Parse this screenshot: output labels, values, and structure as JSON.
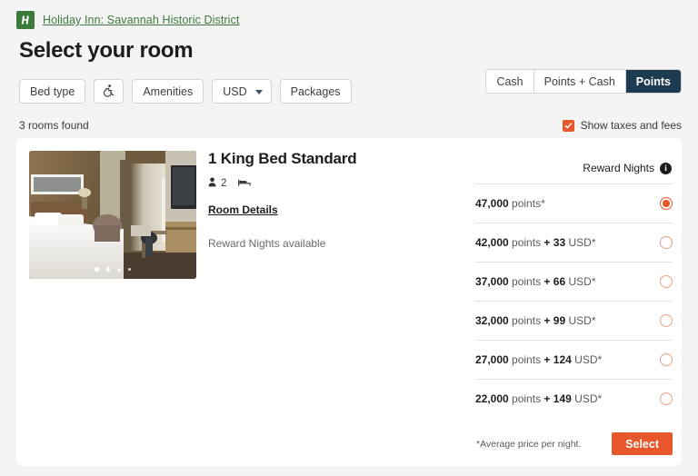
{
  "header": {
    "logo_icon": "holiday-inn-logo-icon",
    "hotel_link": "Holiday Inn: Savannah Historic District",
    "page_title": "Select your room"
  },
  "filters": {
    "items": [
      {
        "label": "Bed type",
        "type": "button"
      },
      {
        "label": "",
        "type": "icon",
        "icon": "accessibility-icon"
      },
      {
        "label": "Amenities",
        "type": "button"
      },
      {
        "label": "USD",
        "type": "select",
        "icon": "chevron-down-icon"
      },
      {
        "label": "Packages",
        "type": "button"
      }
    ]
  },
  "rate_toggle": {
    "options": [
      "Cash",
      "Points + Cash",
      "Points"
    ],
    "selected": "Points",
    "active_color": "#1d3c51"
  },
  "results": {
    "count_label": "3 rooms found",
    "taxes_checkbox": {
      "label": "Show taxes and fees",
      "checked": true,
      "color": "#e8572b",
      "icon": "checkmark-icon"
    }
  },
  "room": {
    "name": "1 King Bed Standard",
    "occupancy_icon": "person-icon",
    "occupancy": "2",
    "bed_icon": "bed-icon",
    "details_link": "Room Details",
    "availability": "Reward Nights available",
    "carousel_dots": 4,
    "carousel_active": 1
  },
  "pricing": {
    "section_label": "Reward Nights",
    "info_icon": "info-icon",
    "info_glyph": "i",
    "options": [
      {
        "points": "47,000",
        "unit": "points*",
        "plus": "",
        "cash": "",
        "cash_unit": "",
        "selected": true
      },
      {
        "points": "42,000",
        "unit": "points",
        "plus": "+",
        "cash": "33",
        "cash_unit": "USD*",
        "selected": false
      },
      {
        "points": "37,000",
        "unit": "points",
        "plus": "+",
        "cash": "66",
        "cash_unit": "USD*",
        "selected": false
      },
      {
        "points": "32,000",
        "unit": "points",
        "plus": "+",
        "cash": "99",
        "cash_unit": "USD*",
        "selected": false
      },
      {
        "points": "27,000",
        "unit": "points",
        "plus": "+",
        "cash": "124",
        "cash_unit": "USD*",
        "selected": false
      },
      {
        "points": "22,000",
        "unit": "points",
        "plus": "+",
        "cash": "149",
        "cash_unit": "USD*",
        "selected": false
      }
    ],
    "footnote": "*Average price per night.",
    "select_label": "Select",
    "select_color": "#e8572b"
  }
}
